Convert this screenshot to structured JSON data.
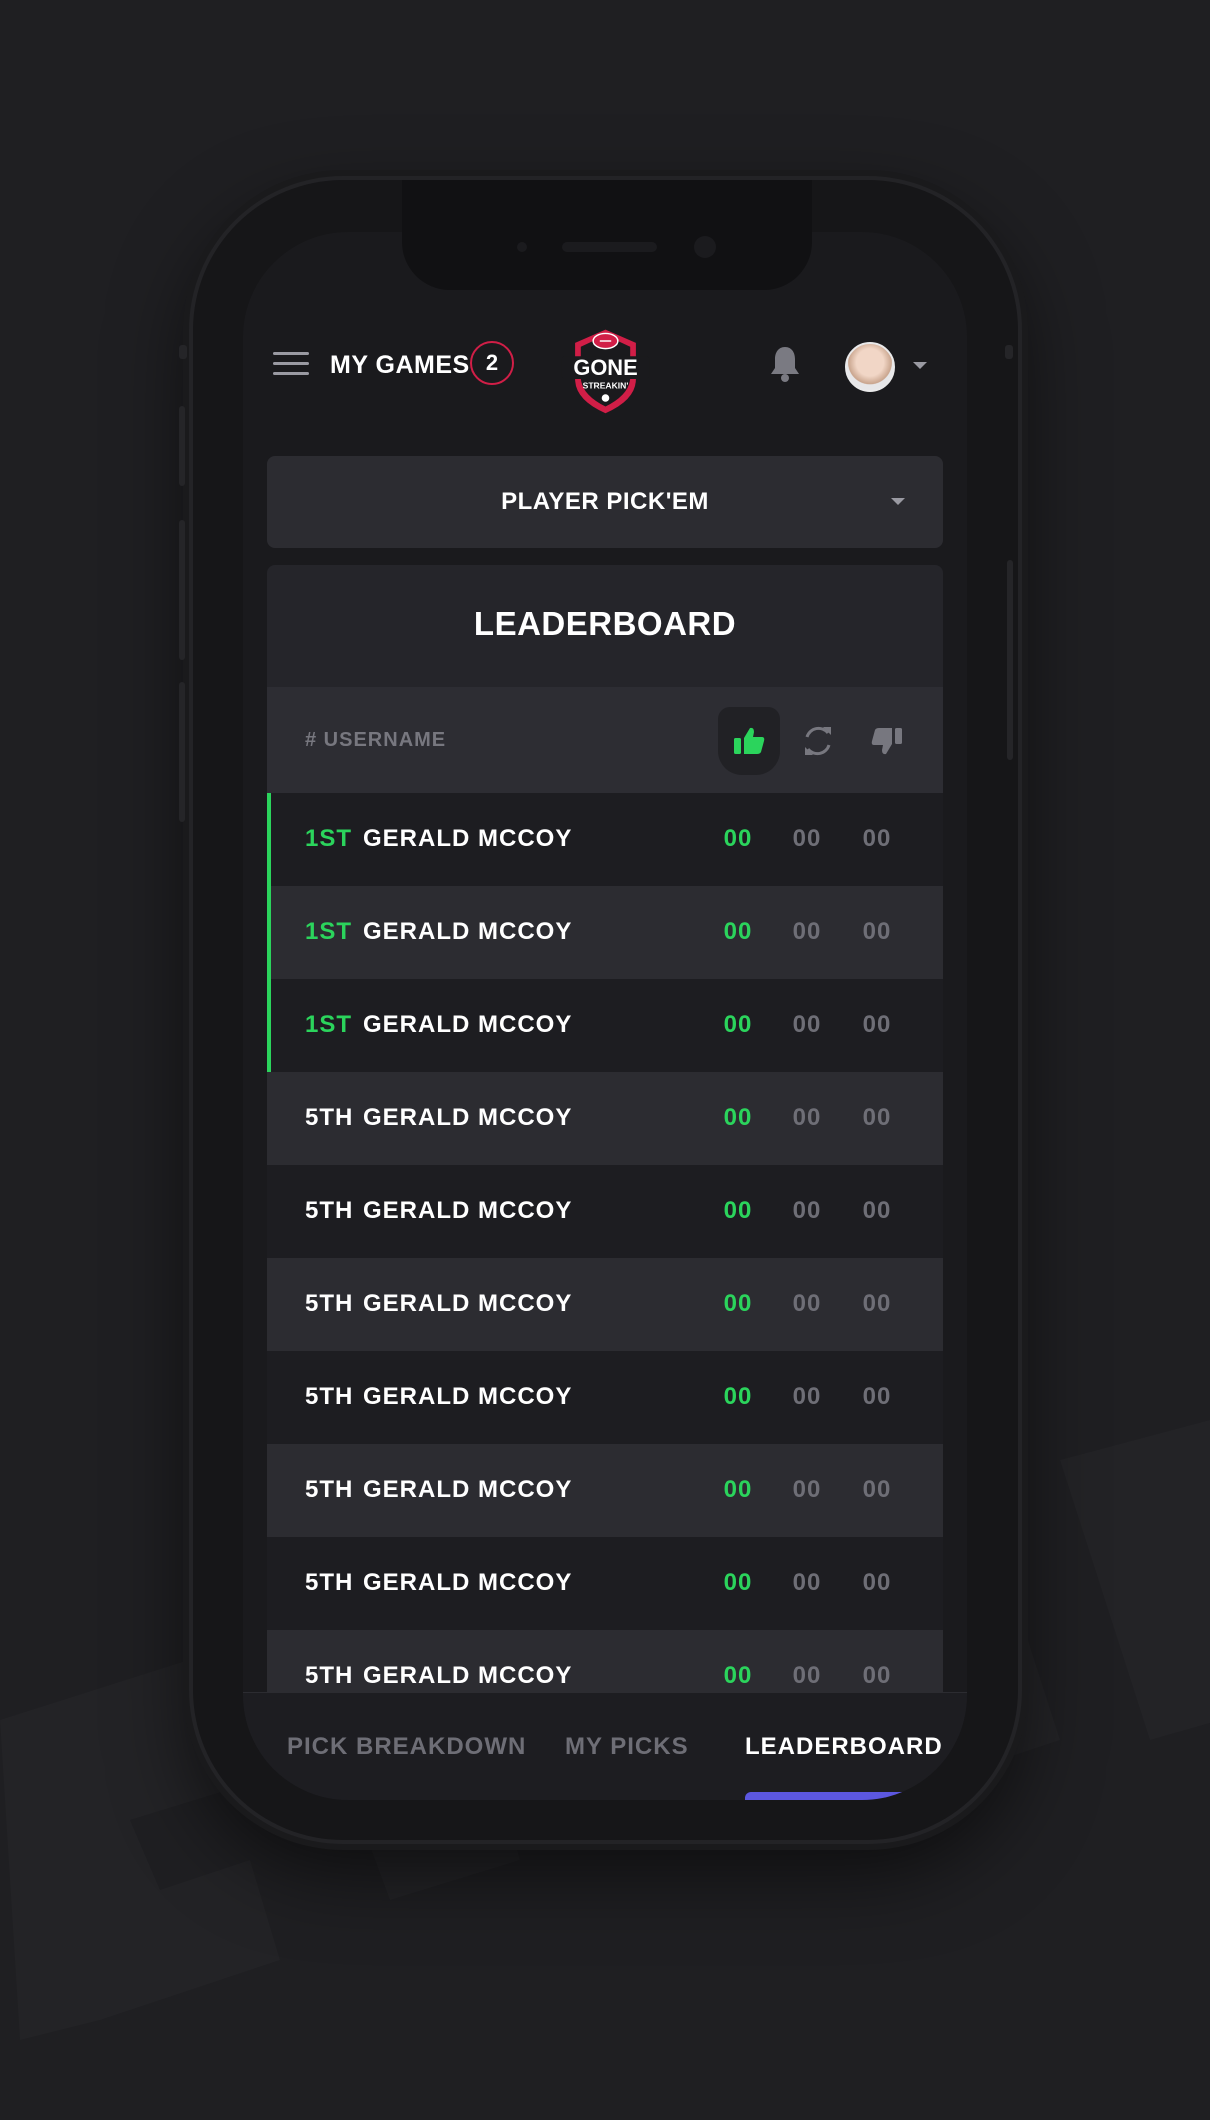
{
  "header": {
    "my_games_label": "MY GAMES",
    "my_games_count": "2"
  },
  "selector": {
    "label": "PLAYER PICK'EM"
  },
  "leaderboard": {
    "title": "LEADERBOARD",
    "column_header": "# USERNAME",
    "columns": [
      "thumbs-up-icon",
      "refresh-icon",
      "thumbs-down-icon"
    ],
    "rows": [
      {
        "rank": "1ST",
        "name": "GERALD MCCOY",
        "wins": "00",
        "pushes": "00",
        "losses": "00"
      },
      {
        "rank": "1ST",
        "name": "GERALD MCCOY",
        "wins": "00",
        "pushes": "00",
        "losses": "00"
      },
      {
        "rank": "1ST",
        "name": "GERALD MCCOY",
        "wins": "00",
        "pushes": "00",
        "losses": "00"
      },
      {
        "rank": "5TH",
        "name": "GERALD MCCOY",
        "wins": "00",
        "pushes": "00",
        "losses": "00"
      },
      {
        "rank": "5TH",
        "name": "GERALD MCCOY",
        "wins": "00",
        "pushes": "00",
        "losses": "00"
      },
      {
        "rank": "5TH",
        "name": "GERALD MCCOY",
        "wins": "00",
        "pushes": "00",
        "losses": "00"
      },
      {
        "rank": "5TH",
        "name": "GERALD MCCOY",
        "wins": "00",
        "pushes": "00",
        "losses": "00"
      },
      {
        "rank": "5TH",
        "name": "GERALD MCCOY",
        "wins": "00",
        "pushes": "00",
        "losses": "00"
      },
      {
        "rank": "5TH",
        "name": "GERALD MCCOY",
        "wins": "00",
        "pushes": "00",
        "losses": "00"
      },
      {
        "rank": "5TH",
        "name": "GERALD MCCOY",
        "wins": "00",
        "pushes": "00",
        "losses": "00"
      }
    ]
  },
  "tabs": [
    {
      "label": "PICK BREAKDOWN",
      "active": false
    },
    {
      "label": "MY PICKS",
      "active": false
    },
    {
      "label": "LEADERBOARD",
      "active": true
    }
  ],
  "logo": {
    "text_top": "GONE",
    "text_bottom": "STREAKIN'"
  },
  "colors": {
    "accent_green": "#2bd45c",
    "accent_red": "#d11e47",
    "tab_indicator": "#5c57e0",
    "muted": "#6e6e76"
  }
}
